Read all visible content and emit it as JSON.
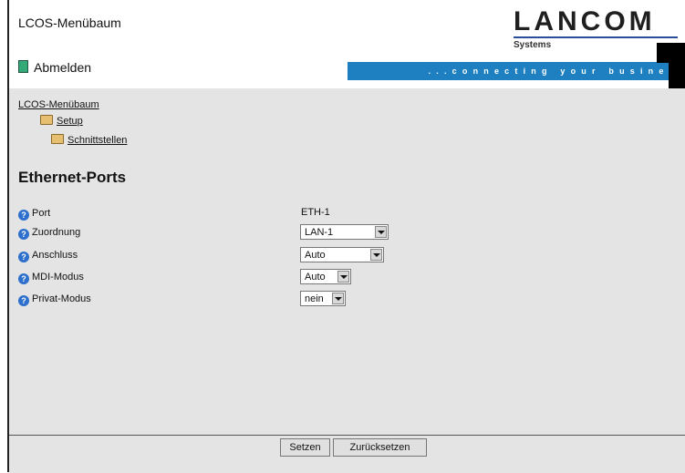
{
  "header": {
    "app_title": "LCOS-Menübaum",
    "logo_text": "LANCOM",
    "logo_sub": "Systems",
    "logout_label": "Abmelden",
    "slogan": "...connecting your business"
  },
  "breadcrumb": {
    "items": [
      "LCOS-Menübaum",
      "Setup",
      "Schnittstellen"
    ]
  },
  "page": {
    "title": "Ethernet-Ports"
  },
  "form": {
    "help_glyph": "?",
    "rows": [
      {
        "label": "Port",
        "value": "ETH-1"
      },
      {
        "label": "Zuordnung",
        "value": "LAN-1"
      },
      {
        "label": "Anschluss",
        "value": "Auto"
      },
      {
        "label": "MDI-Modus",
        "value": "Auto"
      },
      {
        "label": "Privat-Modus",
        "value": "nein"
      }
    ]
  },
  "footer": {
    "set_button": "Setzen",
    "reset_button": "Zurücksetzen"
  },
  "colors": {
    "slogan_bg": "#1e7fc1",
    "content_bg": "#e4e4e4",
    "help_icon": "#2d6fcc"
  },
  "icons": [
    "logout-icon",
    "folder-icon",
    "help-icon",
    "dropdown-arrow-icon"
  ]
}
